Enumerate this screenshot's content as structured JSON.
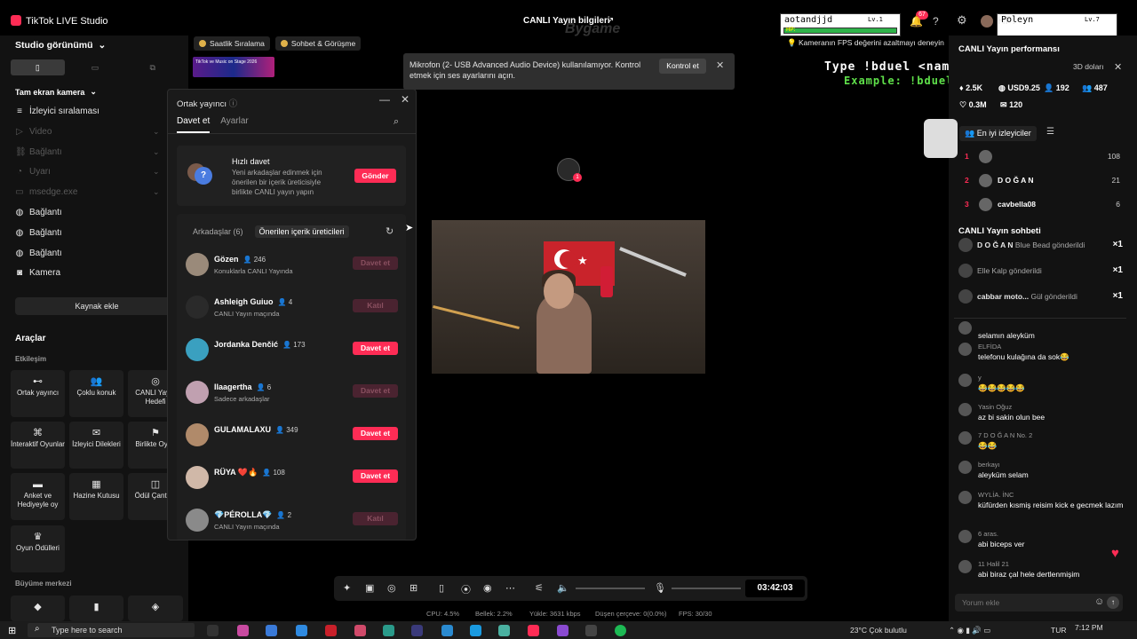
{
  "app": {
    "title": "TikTok LIVE Studio",
    "center_title": "CANLI Yayın bilgileri",
    "watermark": "Bygame"
  },
  "left": {
    "studio_view": "Studio görünümü",
    "full_screen_camera": "Tam ekran kamera",
    "sources": [
      {
        "label": "İzleyici sıralaması",
        "icon": "list-icon",
        "dim": false
      },
      {
        "label": "Video",
        "icon": "play-circle-icon",
        "dim": true
      },
      {
        "label": "Bağlantı",
        "icon": "link-icon",
        "dim": true
      },
      {
        "label": "Uyarı",
        "icon": "alert-icon",
        "dim": true
      },
      {
        "label": "msedge.exe",
        "icon": "window-icon",
        "dim": true
      },
      {
        "label": "Bağlantı",
        "icon": "globe-icon",
        "dim": false
      },
      {
        "label": "Bağlantı",
        "icon": "globe-icon",
        "dim": false
      },
      {
        "label": "Bağlantı",
        "icon": "globe-icon",
        "dim": false
      },
      {
        "label": "Kamera",
        "icon": "camera-icon",
        "dim": false
      }
    ],
    "add_source": "Kaynak ekle",
    "tools": "Araçlar",
    "interaction": "Etkileşim",
    "tiles": [
      {
        "label": "Ortak yayıncı",
        "icon": "co-host-icon"
      },
      {
        "label": "Çoklu konuk",
        "icon": "multi-guest-icon"
      },
      {
        "label": "CANLI Yayın Hedefi",
        "icon": "goal-icon"
      },
      {
        "label": "İnteraktif Oyunlar",
        "icon": "gamepad-icon"
      },
      {
        "label": "İzleyici Dilekleri",
        "icon": "gift-icon"
      },
      {
        "label": "Birlikte Oyna",
        "icon": "play-together-icon"
      },
      {
        "label": "Anket ve Hediyeyle oy",
        "icon": "poll-icon"
      },
      {
        "label": "Hazine Kutusu",
        "icon": "treasure-icon"
      },
      {
        "label": "Ödül Çantası",
        "icon": "bag-icon"
      },
      {
        "label": "Oyun Ödülleri",
        "icon": "trophy-icon"
      }
    ],
    "growth_center": "Büyüme merkezi"
  },
  "chips": [
    {
      "label": "Saatlik Sıralama"
    },
    {
      "label": "Sohbet & Görüşme"
    }
  ],
  "banner_text": "TikTok ve Music on Stage 2026",
  "modal": {
    "title": "Ortak yayıncı",
    "tab_invite": "Davet et",
    "tab_settings": "Ayarlar",
    "quick_title": "Hızlı davet",
    "quick_desc": "Yeni arkadaşlar edinmek için önerilen bir içerik üreticisiyle birlikte CANLI yayın yapın",
    "quick_button": "Gönder",
    "friends_tab": "Arkadaşlar (6)",
    "suggested_tab": "Önerilen içerik üreticileri",
    "rows": [
      {
        "name": "Gözen",
        "count": "246",
        "sub": "Konuklarla CANLI Yayında",
        "action": "Davet et",
        "enabled": false,
        "color": "#9a8a7a"
      },
      {
        "name": "Ashleigh Guiuo",
        "count": "4",
        "sub": "CANLI Yayın maçında",
        "action": "Katıl",
        "enabled": false,
        "color": "#2a2a2a"
      },
      {
        "name": "Jordanka Denčić",
        "count": "173",
        "sub": "",
        "action": "Davet et",
        "enabled": true,
        "color": "#3aa0c0"
      },
      {
        "name": "Ilaagertha",
        "count": "6",
        "sub": "Sadece arkadaşlar",
        "action": "Davet et",
        "enabled": false,
        "color": "#c0a0b0"
      },
      {
        "name": "GULAMALAXU",
        "count": "349",
        "sub": "",
        "action": "Davet et",
        "enabled": true,
        "color": "#b08a6a"
      },
      {
        "name": "RÜYA ❤️🔥",
        "count": "108",
        "sub": "",
        "action": "Davet et",
        "enabled": true,
        "color": "#d0b8a8"
      },
      {
        "name": "💎PÉROLLA💎",
        "count": "2",
        "sub": "CANLI Yayın maçında",
        "action": "Katıl",
        "enabled": false,
        "color": "#8a8a8a"
      }
    ]
  },
  "toast": {
    "text": "Mikrofon (2- USB Advanced Audio Device) kullanılamıyor. Kontrol etmek için ses ayarlarını açın.",
    "button": "Kontrol et"
  },
  "game": {
    "p1_name": "aotandjjd",
    "p1_level": "Lv.1",
    "p1_hp": 1.0,
    "p2_name": "Poleyn",
    "p2_level": "Lv.7",
    "p2_hp": 1.0,
    "hp_label": "HP:",
    "line1": "Type !bduel <name> to play",
    "line2": "Example: !bduel Poleyn"
  },
  "fps_tip": "Kameranın FPS değerini azaltmayı deneyin",
  "notif_count": "67",
  "right": {
    "performance": "CANLI Yayın performansı",
    "earnings": "3D doları",
    "stats": [
      {
        "value": "2.5K",
        "icon": "diamond-icon"
      },
      {
        "value": "USD9.25",
        "icon": "coin-icon"
      },
      {
        "value": "192",
        "icon": "user-icon"
      },
      {
        "value": "487",
        "icon": "users-icon"
      },
      {
        "value": "0.3M",
        "icon": "heart-icon"
      },
      {
        "value": "120",
        "icon": "gift-icon"
      }
    ],
    "top_viewers": "En iyi izleyiciler",
    "ranking": [
      {
        "rank": "1",
        "name": "",
        "value": "108"
      },
      {
        "rank": "2",
        "name": "D O Ğ A N",
        "value": "21"
      },
      {
        "rank": "3",
        "name": "cavbella08",
        "value": "6"
      }
    ],
    "chat_title": "CANLI Yayın sohbeti",
    "gifts": [
      {
        "name": "D O Ğ A N",
        "text": "Blue Bead gönderildi",
        "qty": "×1"
      },
      {
        "name": "",
        "text": "Elle Kalp gönderildi",
        "qty": "×1"
      },
      {
        "name": "cabbar moto...",
        "text": "Gül gönderildi",
        "qty": "×1"
      }
    ],
    "messages": [
      {
        "user": "",
        "text": "selamın aleyküm"
      },
      {
        "user": "ELFİDA",
        "text": "telefonu kulağına da sok😂"
      },
      {
        "user": "y",
        "text": "😂😂😂😂😂"
      },
      {
        "user": "Yasin Oğuz",
        "text": "az bi sakin olun bee"
      },
      {
        "user": "7  D O Ğ A N  No. 2",
        "text": "😂😂"
      },
      {
        "user": "berkayı",
        "text": "aleyküm selam"
      },
      {
        "user": "WYLİA. İNC",
        "text": "küfürden kısmiş reisim kick e gecmek lazım"
      },
      {
        "user": "6  aras.",
        "text": "abi biceps ver"
      },
      {
        "user": "11  Halil 21",
        "text": "abi biraz çal hele dertlenmişim"
      }
    ],
    "comment_placeholder": "Yorum ekle"
  },
  "controls": {
    "timer": "03:42:03"
  },
  "stats": {
    "cpu": "CPU: 4.5%",
    "memory": "Bellek: 2.2%",
    "upload": "Yükle: 3631 kbps",
    "dropped": "Düşen çerçeve: 0(0.0%)",
    "fps": "FPS: 30/30"
  },
  "taskbar": {
    "search": "Type here to search",
    "weather": "23°C  Çok bulutlu",
    "lang": "TUR",
    "time": "7:12 PM"
  }
}
